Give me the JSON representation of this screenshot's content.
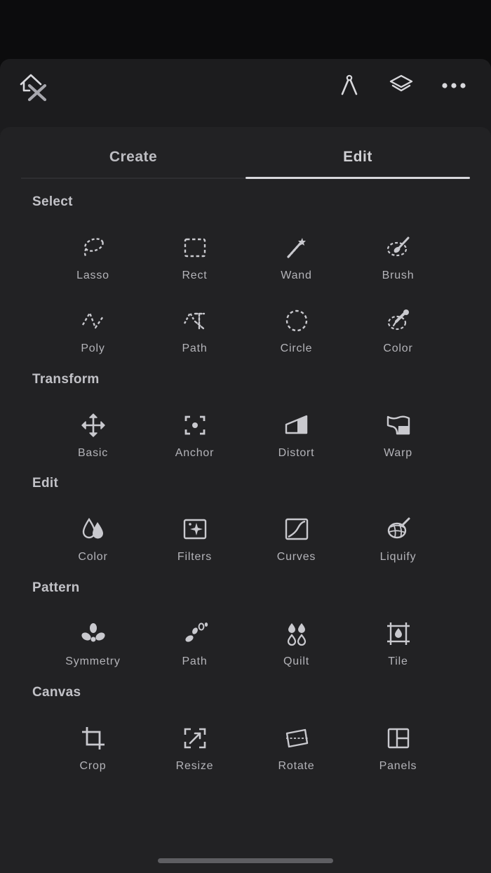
{
  "tabs": [
    {
      "label": "Create",
      "active": false
    },
    {
      "label": "Edit",
      "active": true
    }
  ],
  "sections": [
    {
      "title": "Select",
      "tools": [
        {
          "label": "Lasso",
          "icon": "lasso-icon"
        },
        {
          "label": "Rect",
          "icon": "rect-select-icon"
        },
        {
          "label": "Wand",
          "icon": "magic-wand-icon"
        },
        {
          "label": "Brush",
          "icon": "brush-select-icon"
        },
        {
          "label": "Poly",
          "icon": "poly-lasso-icon"
        },
        {
          "label": "Path",
          "icon": "path-select-icon"
        },
        {
          "label": "Circle",
          "icon": "circle-select-icon"
        },
        {
          "label": "Color",
          "icon": "color-select-icon"
        }
      ]
    },
    {
      "title": "Transform",
      "tools": [
        {
          "label": "Basic",
          "icon": "move-arrows-icon"
        },
        {
          "label": "Anchor",
          "icon": "anchor-icon"
        },
        {
          "label": "Distort",
          "icon": "distort-icon"
        },
        {
          "label": "Warp",
          "icon": "warp-icon"
        }
      ]
    },
    {
      "title": "Edit",
      "tools": [
        {
          "label": "Color",
          "icon": "color-drops-icon"
        },
        {
          "label": "Filters",
          "icon": "filters-icon"
        },
        {
          "label": "Curves",
          "icon": "curves-icon"
        },
        {
          "label": "Liquify",
          "icon": "liquify-icon"
        }
      ]
    },
    {
      "title": "Pattern",
      "tools": [
        {
          "label": "Symmetry",
          "icon": "symmetry-icon"
        },
        {
          "label": "Path",
          "icon": "pattern-path-icon"
        },
        {
          "label": "Quilt",
          "icon": "quilt-icon"
        },
        {
          "label": "Tile",
          "icon": "tile-icon"
        }
      ]
    },
    {
      "title": "Canvas",
      "tools": [
        {
          "label": "Crop",
          "icon": "crop-icon"
        },
        {
          "label": "Resize",
          "icon": "resize-icon"
        },
        {
          "label": "Rotate",
          "icon": "rotate-icon"
        },
        {
          "label": "Panels",
          "icon": "panels-icon"
        }
      ]
    }
  ],
  "colors": {
    "background": "#0c0c0d",
    "topbar": "#1c1c1e",
    "sheet": "#222224",
    "text": "#b4b4b9"
  }
}
